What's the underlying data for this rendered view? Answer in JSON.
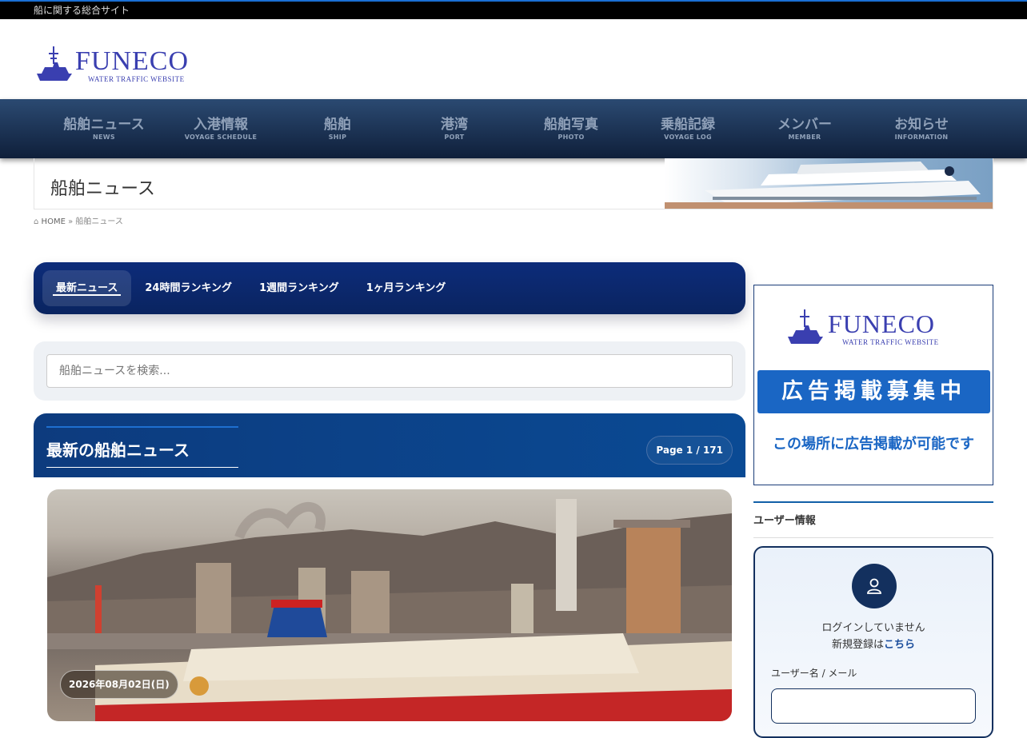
{
  "topbar": {
    "tagline": "船に関する総合サイト"
  },
  "logo": {
    "name": "FUNECO",
    "subtitle": "WATER TRAFFIC WEBSITE"
  },
  "nav": [
    {
      "jp": "船舶ニュース",
      "en": "NEWS"
    },
    {
      "jp": "入港情報",
      "en": "VOYAGE SCHEDULE"
    },
    {
      "jp": "船舶",
      "en": "SHIP"
    },
    {
      "jp": "港湾",
      "en": "PORT"
    },
    {
      "jp": "船舶写真",
      "en": "PHOTO"
    },
    {
      "jp": "乗船記録",
      "en": "VOYAGE LOG"
    },
    {
      "jp": "メンバー",
      "en": "MEMBER"
    },
    {
      "jp": "お知らせ",
      "en": "INFORMATION"
    }
  ],
  "page": {
    "title": "船舶ニュース"
  },
  "breadcrumb": {
    "home": "HOME",
    "sep": "»",
    "current": "船舶ニュース"
  },
  "tabs": [
    {
      "label": "最新ニュース",
      "active": true
    },
    {
      "label": "24時間ランキング"
    },
    {
      "label": "1週間ランキング"
    },
    {
      "label": "1ヶ月ランキング"
    }
  ],
  "search": {
    "placeholder": "船舶ニュースを検索..."
  },
  "news": {
    "heading": "最新の船舶ニュース",
    "page_label": "Page 1 / 171",
    "first_date": "2026年08月02日(日)"
  },
  "ad": {
    "line1": "広告掲載募集中",
    "line2": "この場所に広告掲載が可能です"
  },
  "user": {
    "heading": "ユーザー情報",
    "status": "ログインしていません",
    "register_prefix": "新規登録は",
    "register_link": "こちら",
    "username_label": "ユーザー名 / メール"
  },
  "colors": {
    "nav_dark": "#0f1f3a",
    "accent": "#1a66c4",
    "tab_bg": "#0b2a6e"
  }
}
